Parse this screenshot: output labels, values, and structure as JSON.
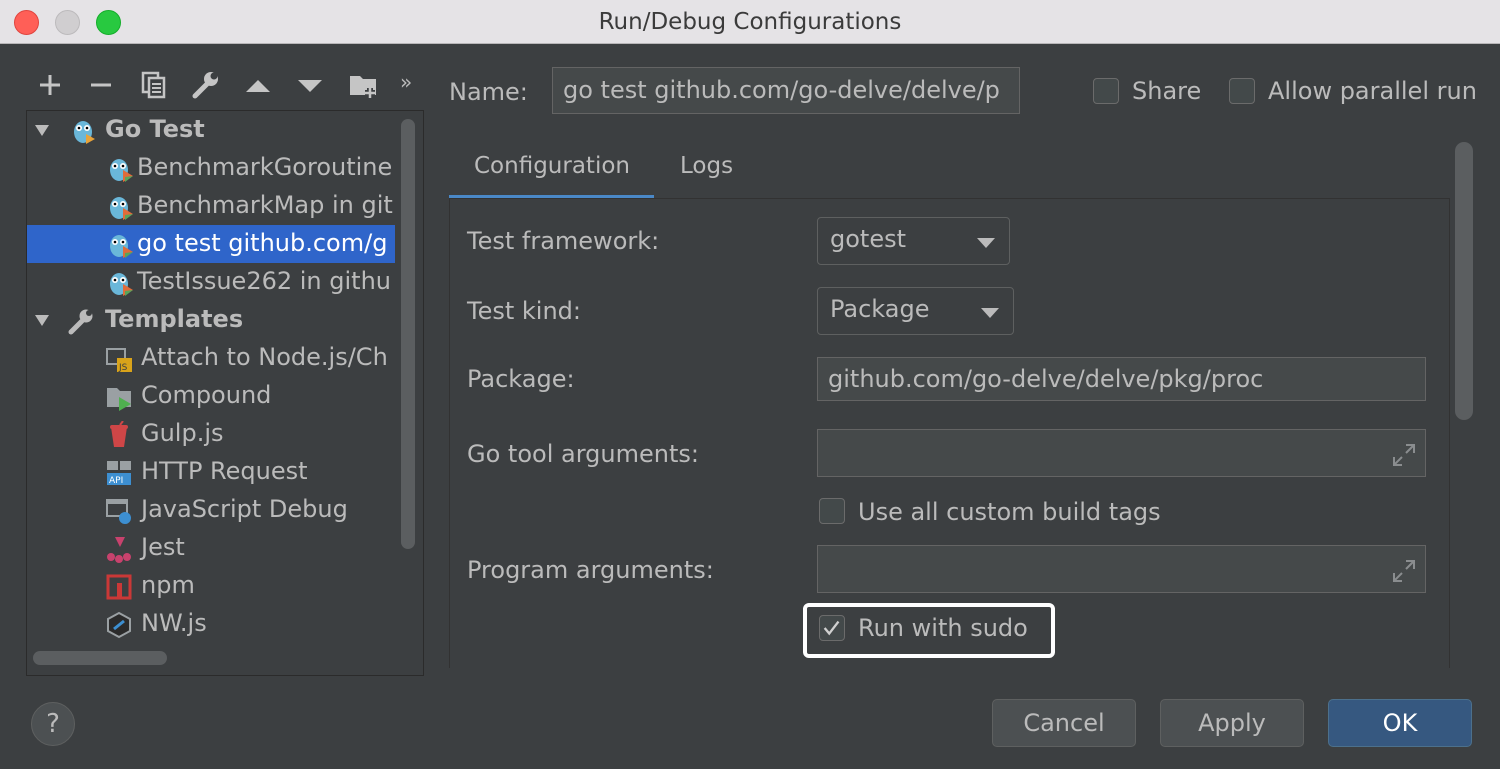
{
  "window": {
    "title": "Run/Debug Configurations"
  },
  "toolbar": {
    "icons": [
      "add-icon",
      "remove-icon",
      "copy-icon",
      "wrench-icon",
      "move-up-icon",
      "move-down-icon",
      "folder-add-icon",
      "more-icon"
    ],
    "more_label": "»"
  },
  "tree": {
    "go_test_group": "Go Test",
    "go_test_items": [
      "BenchmarkGoroutine",
      "BenchmarkMap in git",
      "go test github.com/g",
      "TestIssue262 in githu"
    ],
    "templates_group": "Templates",
    "template_items": [
      "Attach to Node.js/Ch",
      "Compound",
      "Gulp.js",
      "HTTP Request",
      "JavaScript Debug",
      "Jest",
      "npm",
      "NW.js"
    ]
  },
  "name_row": {
    "label": "Name:",
    "value": "go test github.com/go-delve/delve/p",
    "share_label": "Share",
    "allow_parallel_label": "Allow parallel run"
  },
  "tabs": [
    "Configuration",
    "Logs"
  ],
  "form": {
    "test_framework_label": "Test framework:",
    "test_framework_value": "gotest",
    "test_kind_label": "Test kind:",
    "test_kind_value": "Package",
    "package_label": "Package:",
    "package_value": "github.com/go-delve/delve/pkg/proc",
    "go_tool_args_label": "Go tool arguments:",
    "use_build_tags_label": "Use all custom build tags",
    "program_args_label": "Program arguments:",
    "run_with_sudo_label": "Run with sudo",
    "run_with_sudo_checked": true
  },
  "buttons": {
    "help": "?",
    "cancel": "Cancel",
    "apply": "Apply",
    "ok": "OK"
  },
  "colors": {
    "accent": "#4a88c7",
    "selection": "#2f65ca",
    "primary_button": "#365880"
  }
}
